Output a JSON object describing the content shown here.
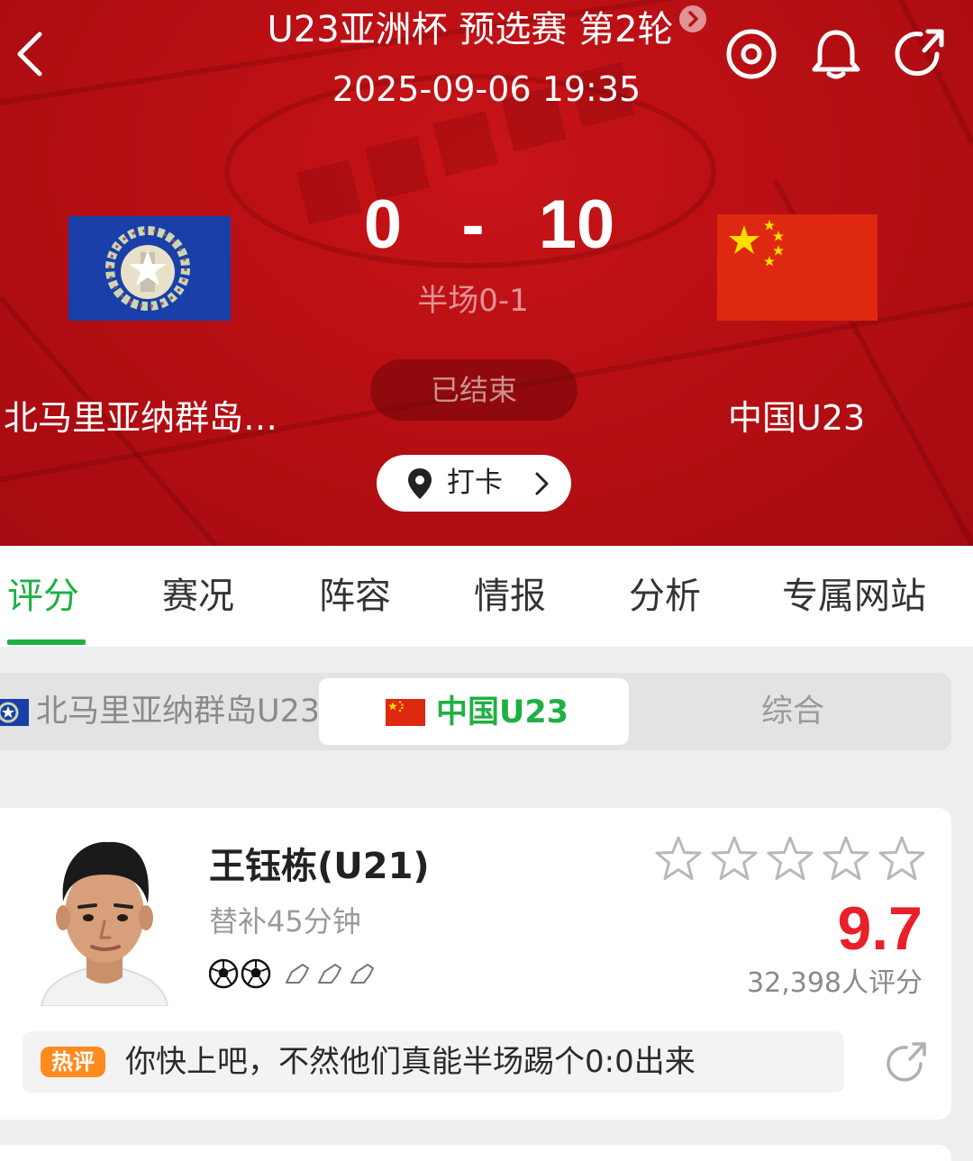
{
  "header": {
    "title": "U23亚洲杯 预选赛 第2轮",
    "datetime": "2025-09-06 19:35",
    "score_home": "0",
    "score_sep": "-",
    "score_away": "10",
    "halftime": "半场0-1",
    "status": "已结束",
    "team_home": "北马里亚纳群岛…",
    "team_away": "中国U23",
    "checkin_label": "打卡",
    "icons": [
      "back-icon",
      "target-icon",
      "bell-icon",
      "share-icon"
    ]
  },
  "tabs": [
    "评分",
    "赛况",
    "阵容",
    "情报",
    "分析",
    "专属网站"
  ],
  "active_tab": "评分",
  "team_selector": {
    "home": "北马里亚纳群岛U23",
    "away": "中国U23",
    "all": "综合",
    "selected": "中国U23"
  },
  "player": {
    "name": "王钰栋(U21)",
    "subtitle": "替补45分钟",
    "goals": 2,
    "assists": 3,
    "star_count": 5,
    "rating": "9.7",
    "rating_count": "32,398人评分"
  },
  "hot_comment": {
    "badge": "热评",
    "text": "你快上吧，不然他们真能半场踢个0:0出来"
  },
  "colors": {
    "header_red": "#b80f14",
    "accent_green": "#1fb043",
    "rating_red": "#e8202a",
    "hot_orange": "#ff8a1e"
  }
}
